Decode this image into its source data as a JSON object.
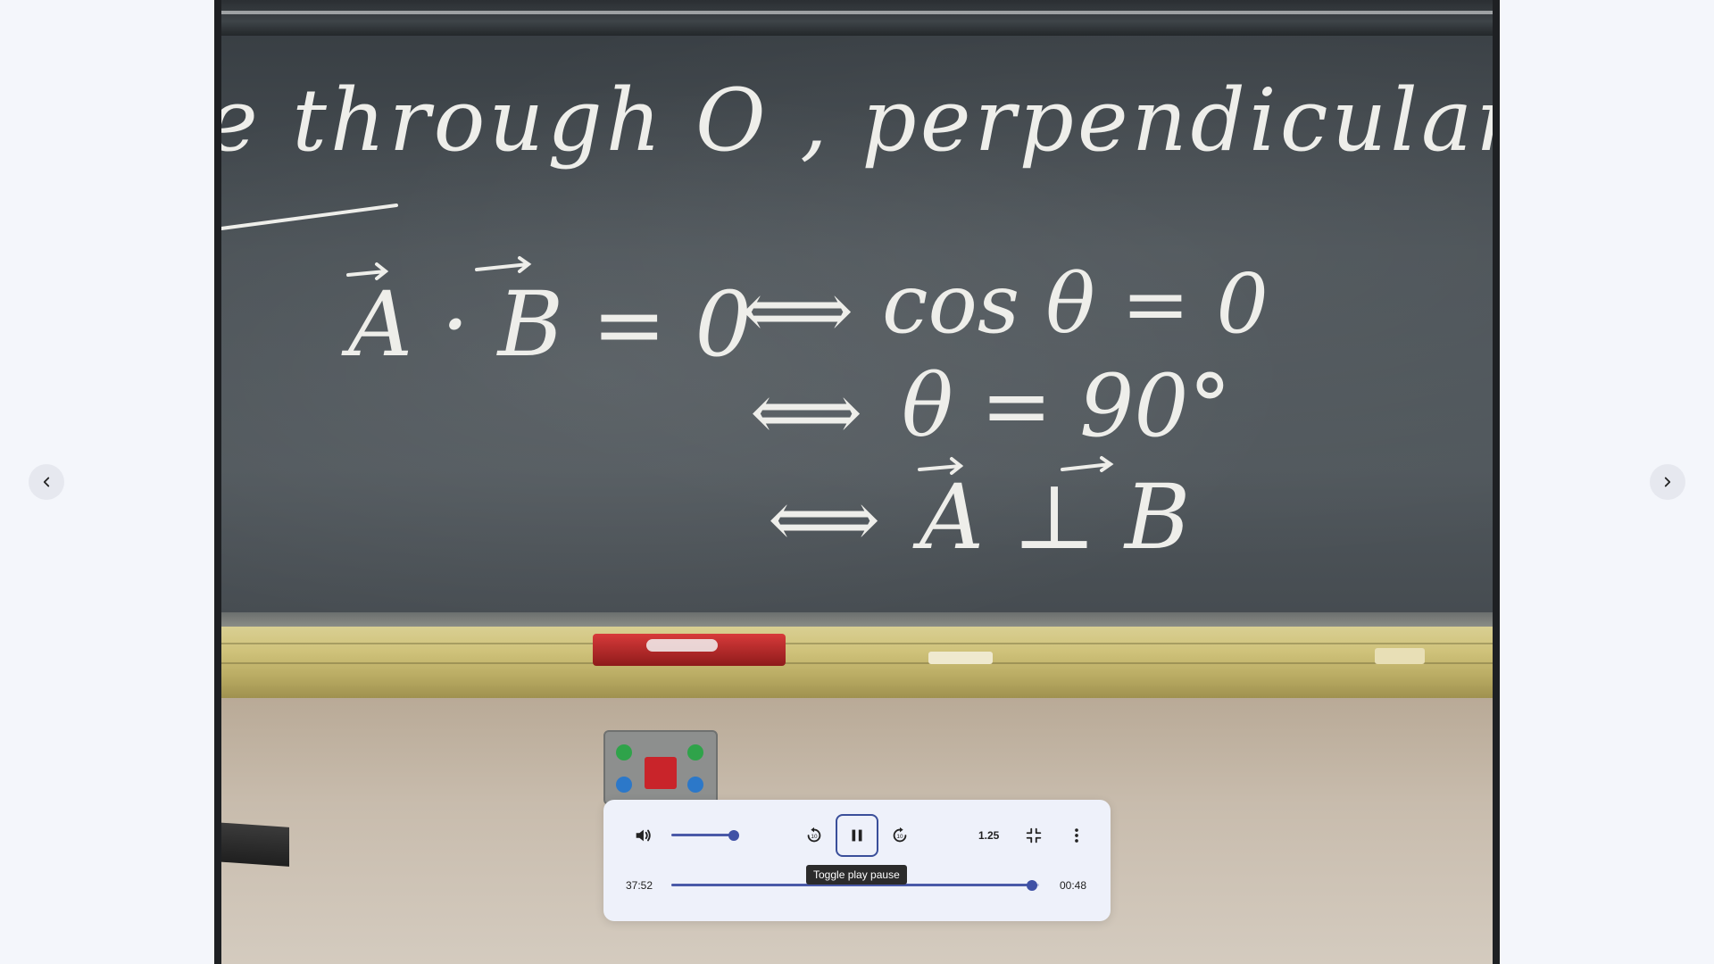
{
  "player": {
    "current_time": "37:52",
    "remaining_time": "00:48",
    "speed": "1.25",
    "play_tooltip": "Toggle play pause",
    "volume_level": 0.88,
    "progress_level": 0.98
  },
  "blackboard": {
    "line1": "e through O ,  perpendicular to A",
    "eq1_left": "A · B = 0",
    "eq1_right": "cos θ = 0",
    "eq2": "θ = 90°",
    "eq3": "A ⊥ B",
    "iff": "⟺"
  },
  "icons": {
    "prev": "chevron-left-icon",
    "next": "chevron-right-icon",
    "volume": "volume-icon",
    "rewind": "replay-10-icon",
    "pause": "pause-icon",
    "forward": "forward-10-icon",
    "exit_fullscreen": "fullscreen-exit-icon",
    "more": "more-vertical-icon"
  },
  "colors": {
    "accent": "#3f51a5",
    "control_bg": "#eef1fa",
    "tooltip_bg": "#2b2b2b"
  }
}
